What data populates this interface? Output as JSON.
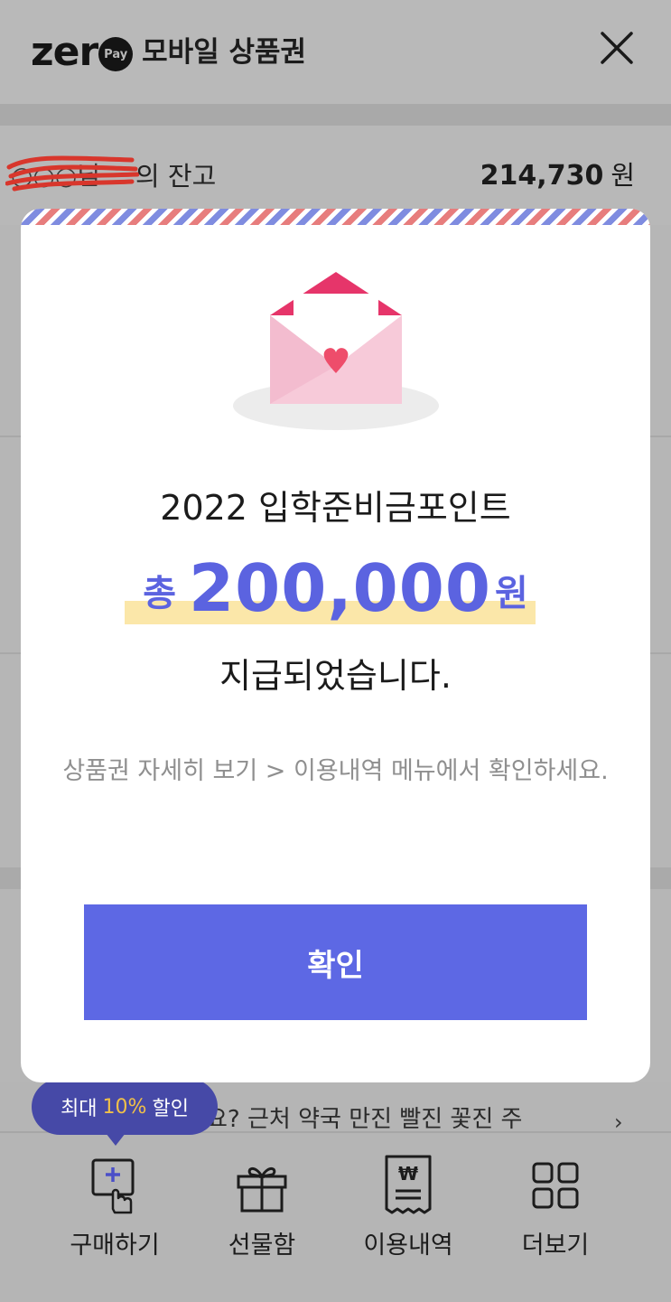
{
  "header": {
    "logo_word": "zer",
    "logo_badge": "Pay",
    "title": "모바일 상품권",
    "close_icon": "close-icon"
  },
  "balance": {
    "owner_redacted": "○○○님",
    "label": "의 잔고",
    "amount": "214,730",
    "unit": "원"
  },
  "modal": {
    "title": "2022 입학준비금포인트",
    "amount_prefix": "총",
    "amount": "200,000",
    "amount_unit": "원",
    "subtitle": "지급되었습니다.",
    "note": "상품권 자세히 보기 > 이용내역 메뉴에서 확인하세요.",
    "confirm_label": "확인",
    "envelope_icon": "envelope-heart-icon",
    "colors": {
      "accent": "#5d68e4",
      "highlight": "#fbe7a9",
      "envelope_pink": "#f6c9d8",
      "envelope_flap": "#e63a6a"
    }
  },
  "promo": {
    "bubble_prefix": "최대",
    "bubble_percent": "10%",
    "bubble_suffix": "할인",
    "text": "요? 근처 약국 만진 빨진 꽃진 주",
    "chevron": "›"
  },
  "nav": [
    {
      "label": "구매하기",
      "icon": "purchase-icon"
    },
    {
      "label": "선물함",
      "icon": "gift-icon"
    },
    {
      "label": "이용내역",
      "icon": "receipt-icon"
    },
    {
      "label": "더보기",
      "icon": "grid-icon"
    }
  ]
}
